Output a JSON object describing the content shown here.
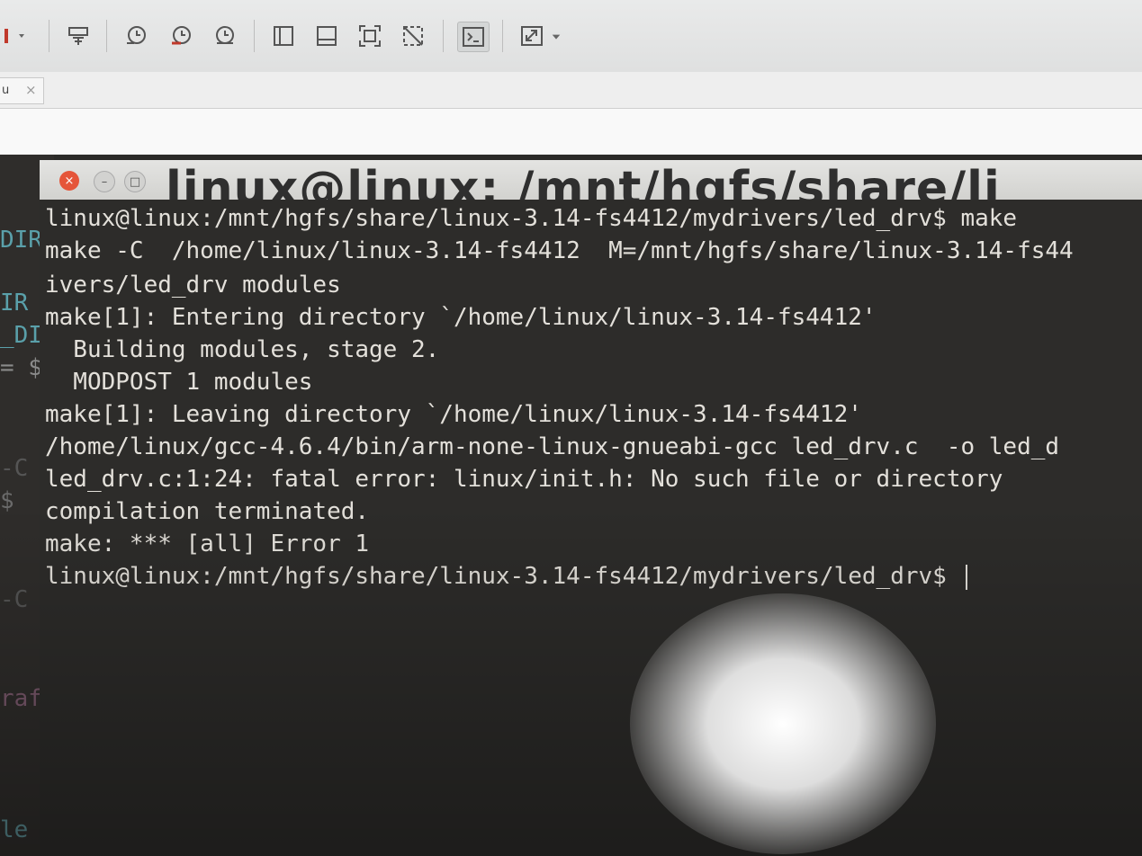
{
  "host_toolbar": {
    "buttons": [
      {
        "icon": "dropdown-icon"
      },
      {
        "icon": "send-keys-icon"
      },
      {
        "icon": "snapshot-icon"
      },
      {
        "icon": "revert-snapshot-icon"
      },
      {
        "icon": "snapshot-manager-icon"
      },
      {
        "icon": "sidebar-icon"
      },
      {
        "icon": "thumbnail-bar-icon"
      },
      {
        "icon": "fullscreen-icon"
      },
      {
        "icon": "unity-icon"
      },
      {
        "icon": "console-view-icon"
      },
      {
        "icon": "stretch-icon"
      }
    ]
  },
  "host_tab": {
    "label": "u",
    "close": "×"
  },
  "background_terminal": {
    "fragments": [
      "DIR",
      "IR",
      "_DI",
      "= $",
      "-C",
      "$",
      "-C",
      "raf",
      "le"
    ]
  },
  "terminal": {
    "title": "linux@linux: /mnt/hgfs/share/li",
    "lines": [
      "linux@linux:/mnt/hgfs/share/linux-3.14-fs4412/mydrivers/led_drv$ make",
      "make -C  /home/linux/linux-3.14-fs4412  M=/mnt/hgfs/share/linux-3.14-fs44",
      "ivers/led_drv modules",
      "make[1]: Entering directory `/home/linux/linux-3.14-fs4412'",
      "  Building modules, stage 2.",
      "  MODPOST 1 modules",
      "make[1]: Leaving directory `/home/linux/linux-3.14-fs4412'",
      "/home/linux/gcc-4.6.4/bin/arm-none-linux-gnueabi-gcc led_drv.c  -o led_d",
      "led_drv.c:1:24: fatal error: linux/init.h: No such file or directory",
      "compilation terminated.",
      "make: *** [all] Error 1",
      "linux@linux:/mnt/hgfs/share/linux-3.14-fs4412/mydrivers/led_drv$ "
    ]
  }
}
